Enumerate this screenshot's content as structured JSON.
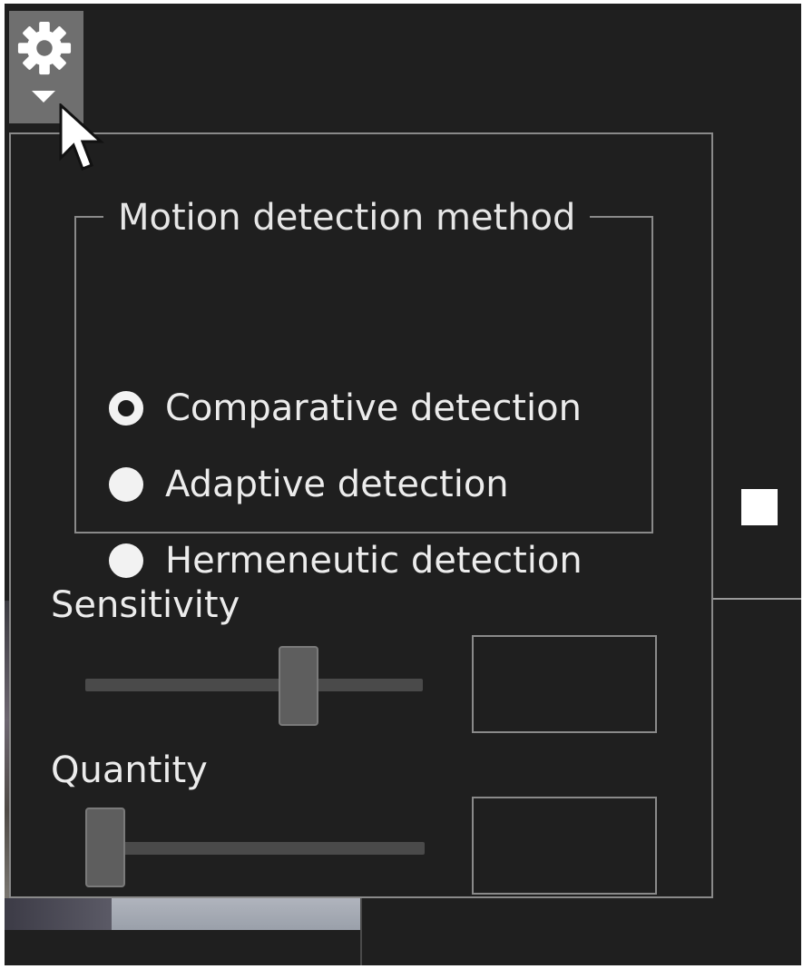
{
  "toolbar": {
    "settings_icon": "gear-icon",
    "dropdown_icon": "caret-down-icon"
  },
  "motion_panel": {
    "method_group": {
      "legend": "Motion detection method",
      "options": [
        {
          "label": "Comparative detection",
          "selected": true
        },
        {
          "label": "Adaptive detection",
          "selected": false
        },
        {
          "label": "Hermeneutic detection",
          "selected": false
        }
      ]
    },
    "sensitivity": {
      "label": "Sensitivity",
      "value_fraction": 0.65,
      "value_text": ""
    },
    "quantity": {
      "label": "Quantity",
      "value_fraction": 0.0,
      "value_text": ""
    }
  },
  "colors": {
    "background": "#1f1f1f",
    "border": "#8a8a8a",
    "text": "#ececec"
  }
}
